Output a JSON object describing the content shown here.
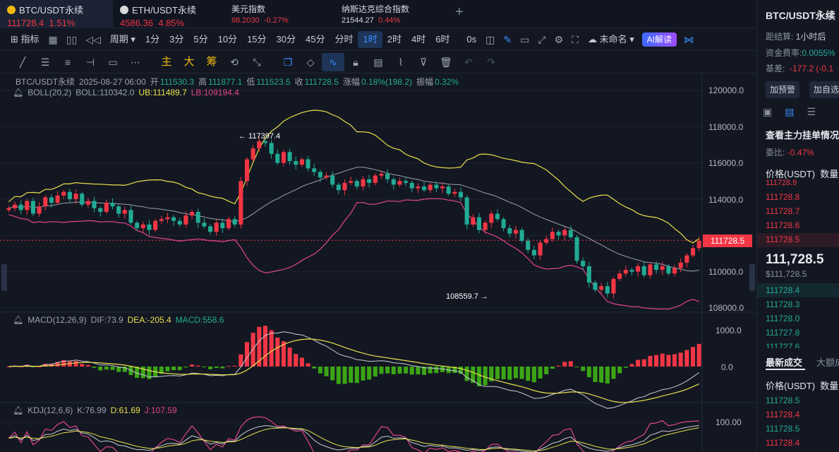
{
  "tabs": [
    {
      "name": "BTC/USDT永续",
      "price": "111728.4",
      "change": "1.51%",
      "icon": "btc-coin-icon"
    },
    {
      "name": "ETH/USDT永续",
      "price": "4586.36",
      "change": "4.85%",
      "icon": "eth-coin-icon"
    },
    {
      "name": "美元指数",
      "price": "98.2030",
      "change": "-0.27%"
    },
    {
      "name": "纳斯达克综合指数",
      "price": "21544.27",
      "change": "0.44%"
    }
  ],
  "toolbar": {
    "indicators": "指标",
    "period": "周期",
    "intervals": [
      "1分",
      "3分",
      "5分",
      "10分",
      "15分",
      "30分",
      "45分",
      "分时",
      "1时",
      "2时",
      "4时",
      "6时"
    ],
    "selected_interval": "1时",
    "zero_s": "0s",
    "layout_name": "未命名",
    "ai_label": "AI解读"
  },
  "drawbar": {
    "main": "主",
    "large": "大",
    "chip": "筹"
  },
  "chart": {
    "header": {
      "symbol": "BTC/USDT永续",
      "date": "2025-08-27 06:00",
      "open_label": "开",
      "open": "111530.3",
      "high_label": "高",
      "high": "111877.1",
      "low_label": "低",
      "low": "111523.5",
      "close_label": "收",
      "close": "111728.5",
      "change_label": "涨幅",
      "change": "0.18%(198.2)",
      "amp_label": "振幅",
      "amp": "0.32%"
    },
    "boll": {
      "name": "BOLL(20,2)",
      "mid": "BOLL:110342.0",
      "ub": "UB:111489.7",
      "lb": "LB:109194.4"
    },
    "macd": {
      "name": "MACD(12,26,9)",
      "dif": "DIF:73.9",
      "dea": "DEA:-205.4",
      "macd": "MACD:558.6"
    },
    "kdj": {
      "name": "KDJ(12,6,6)",
      "k": "K:76.99",
      "d": "D:61.69",
      "j": "J:107.59"
    },
    "price_axis": [
      "120000.0",
      "118000.0",
      "116000.0",
      "114000.0",
      "112000.0",
      "110000.0",
      "108000.0"
    ],
    "macd_axis": [
      "1000.0",
      "0.0"
    ],
    "kdj_axis": [
      "100.00"
    ],
    "last_price": "111728.5",
    "high_mark": "← 117397.4",
    "low_mark": "108559.7 →",
    "colors": {
      "up": "#f23645",
      "down": "#22ab94",
      "ub": "#e8e04a",
      "lb": "#e0468a",
      "mid": "#9aa0ad"
    }
  },
  "chart_data": {
    "type": "candlestick",
    "symbol": "BTC/USDT永续",
    "interval": "1时",
    "ylim": [
      107000,
      121000
    ],
    "close_path": [
      113500,
      113700,
      113400,
      113900,
      113200,
      113600,
      114100,
      113800,
      114200,
      114400,
      114000,
      114300,
      113700,
      113900,
      113500,
      113300,
      113800,
      113600,
      113200,
      113400,
      112700,
      112400,
      112600,
      112300,
      112800,
      112900,
      113000,
      112800,
      112600,
      113100,
      113300,
      112700,
      112500,
      112200,
      112700,
      112400,
      112900,
      112600,
      115000,
      116200,
      116800,
      117200,
      117100,
      116500,
      116000,
      116600,
      116100,
      115900,
      116200,
      115700,
      115500,
      115200,
      115300,
      114800,
      114500,
      114900,
      115000,
      114700,
      115100,
      114900,
      115300,
      115400,
      115100,
      114800,
      115000,
      114900,
      114600,
      114700,
      114500,
      114800,
      114600,
      114700,
      114300,
      114400,
      114100,
      112600,
      113000,
      112300,
      112700,
      113200,
      112900,
      112400,
      112100,
      112300,
      111700,
      111200,
      110900,
      111600,
      111800,
      112200,
      112000,
      112300,
      111900,
      110600,
      110300,
      109400,
      109000,
      109200,
      108800,
      109600,
      109900,
      110100,
      110000,
      110300,
      109800,
      110400,
      110100,
      110300,
      109900,
      110200,
      110500,
      110900,
      111300,
      111700
    ]
  },
  "panel": {
    "title": "BTC/USDT永续",
    "settle_label": "距结算:",
    "settle": "1小时后",
    "fund_label": "资金费率:",
    "fund": "0.0055%",
    "basis_label": "基差:",
    "basis": "-177.2 (-0.1",
    "alert_btn": "加预警",
    "fav_btn": "加自选",
    "depth_title": "查看主力挂单情况",
    "ratio_label": "委比:",
    "ratio": "-0.47%",
    "col_price": "价格(USDT)",
    "col_qty": "数量",
    "asks": [
      "111728.9",
      "111728.8",
      "111728.7",
      "111728.6",
      "111728.5"
    ],
    "last_big": "111,728.5",
    "last_small": "$111,728.5",
    "bids": [
      "111728.4",
      "111728.3",
      "111728.0",
      "111727.8",
      "111727.6"
    ],
    "trades_title": "最新成交",
    "bigorders": "大额成",
    "trades": [
      "111728.5",
      "111728.4",
      "111728.5",
      "111728.4"
    ]
  }
}
